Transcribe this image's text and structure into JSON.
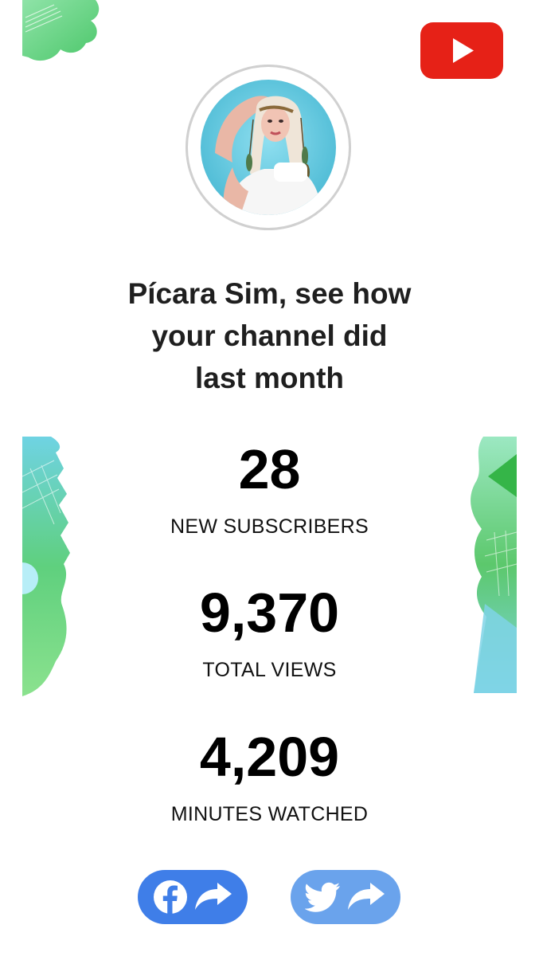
{
  "headline": {
    "line1": "Pícara Sim, see how",
    "line2": "your channel did",
    "line3": "last month"
  },
  "stats": [
    {
      "value": "28",
      "label": "NEW SUBSCRIBERS"
    },
    {
      "value": "9,370",
      "label": "TOTAL VIEWS"
    },
    {
      "value": "4,209",
      "label": "MINUTES WATCHED"
    }
  ],
  "share": {
    "facebook_icon": "facebook-icon",
    "twitter_icon": "twitter-icon",
    "share_icon": "share-arrow-icon"
  },
  "colors": {
    "youtube_red": "#e62117",
    "facebook_button": "#3f7ee8",
    "twitter_button": "#6aa3ec",
    "decoration_green": "#4cc76a",
    "decoration_teal": "#6fd3e3"
  }
}
